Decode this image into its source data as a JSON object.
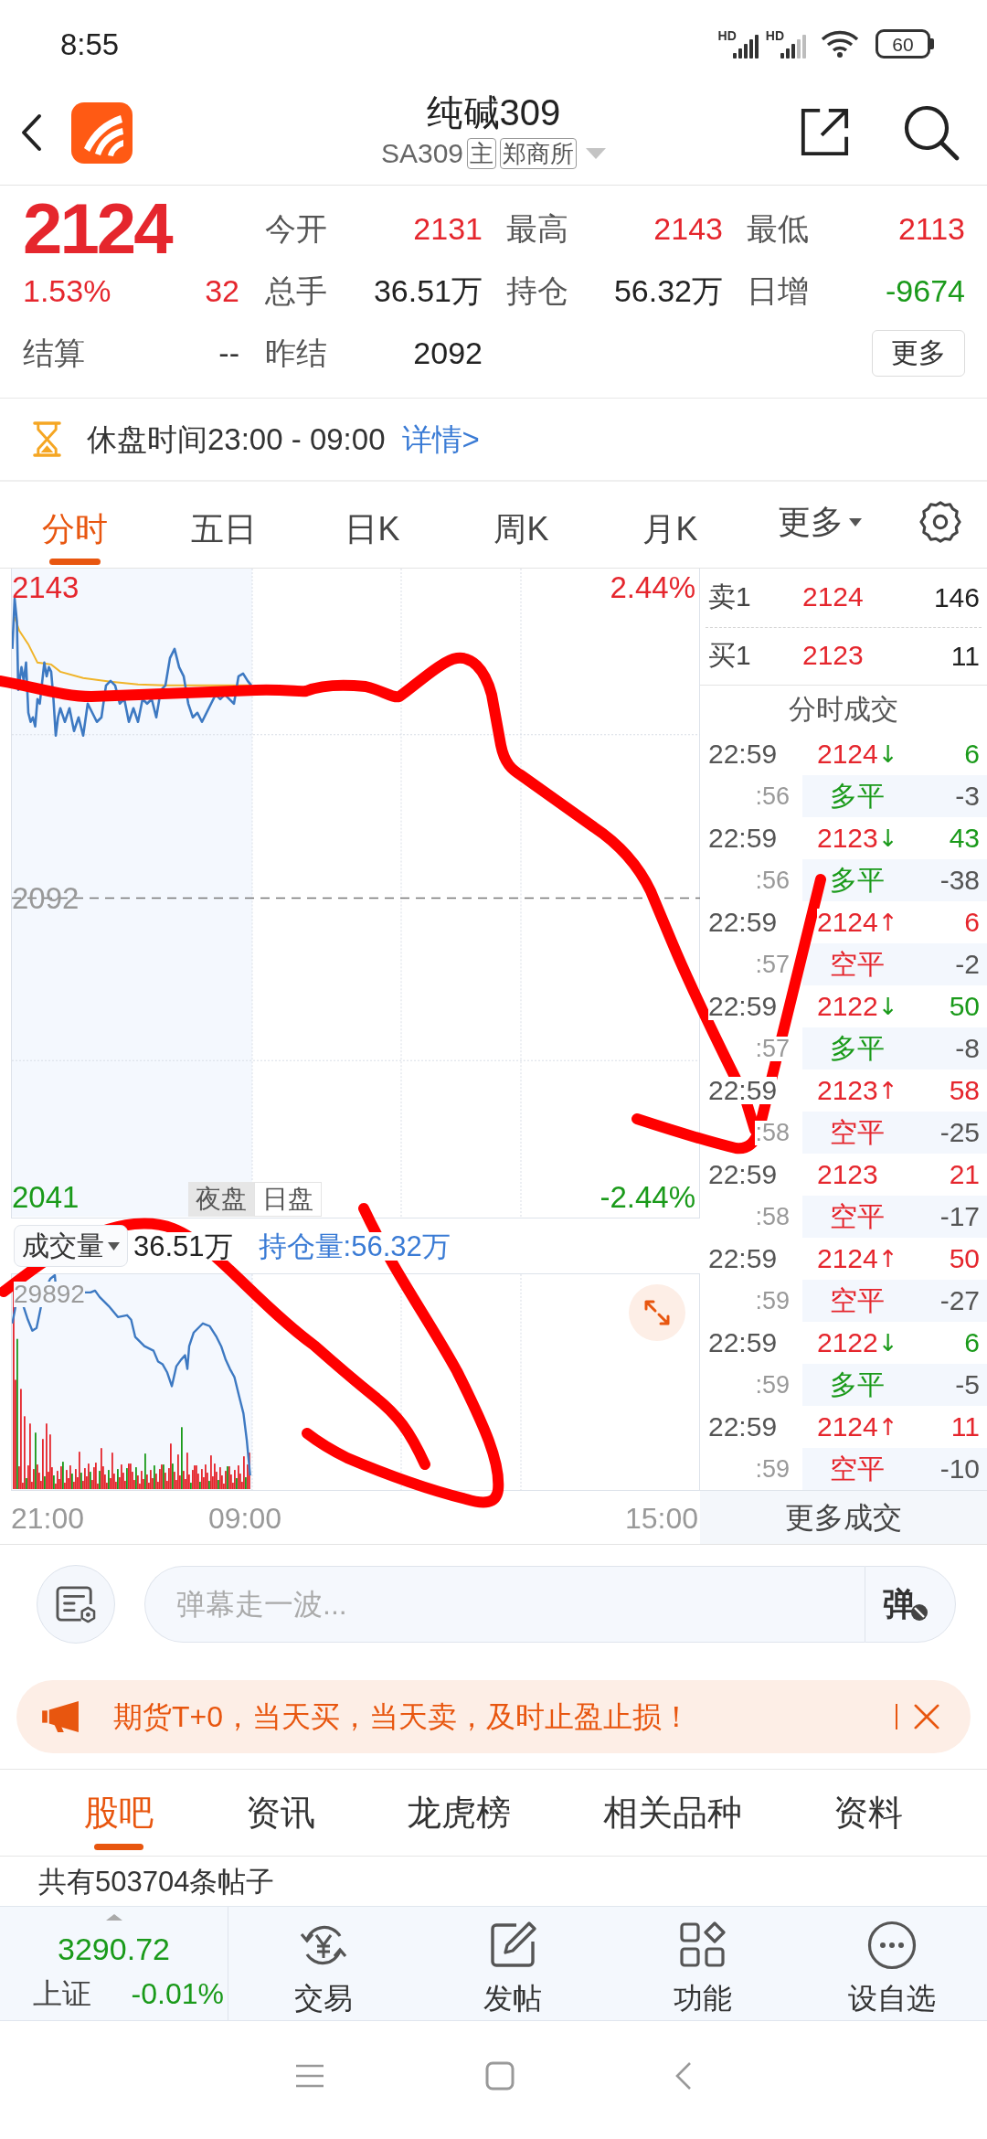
{
  "status_bar": {
    "time": "8:55",
    "signal_labels": [
      "HD",
      "HD"
    ],
    "battery": "60"
  },
  "header": {
    "title": "纯碱309",
    "code": "SA309",
    "tags": [
      "主",
      "郑商所"
    ]
  },
  "quote": {
    "price": "2124",
    "change_pct": "1.53%",
    "change": "32",
    "color": "#e5262d",
    "settlement_label": "结算",
    "settlement_value": "--",
    "stats": [
      {
        "label": "今开",
        "value": "2131",
        "color": "#e5262d"
      },
      {
        "label": "最高",
        "value": "2143",
        "color": "#e5262d"
      },
      {
        "label": "最低",
        "value": "2113",
        "color": "#e5262d"
      },
      {
        "label": "总手",
        "value": "36.51万",
        "color": "#222222"
      },
      {
        "label": "持仓",
        "value": "56.32万",
        "color": "#222222"
      },
      {
        "label": "日增",
        "value": "-9674",
        "color": "#1a9a1a"
      },
      {
        "label": "昨结",
        "value": "2092",
        "color": "#222222"
      }
    ],
    "more_button": "更多"
  },
  "session_notice": {
    "text": "休盘时间23:00 - 09:00",
    "link": "详情>"
  },
  "chart_tabs": [
    {
      "label": "分时",
      "selected": true,
      "kind": "tab"
    },
    {
      "label": "五日",
      "selected": false,
      "kind": "tab"
    },
    {
      "label": "日K",
      "selected": false,
      "kind": "tab"
    },
    {
      "label": "周K",
      "selected": false,
      "kind": "tab"
    },
    {
      "label": "月K",
      "selected": false,
      "kind": "tab"
    },
    {
      "label": "更多",
      "selected": false,
      "kind": "menu"
    }
  ],
  "price_chart": {
    "high": "2143",
    "high_pct": "2.44%",
    "base": "2092",
    "low": "2041",
    "low_pct": "-2.44%",
    "sessions": [
      {
        "label": "夜盘",
        "selected": true
      },
      {
        "label": "日盘",
        "selected": false
      }
    ]
  },
  "volume_chart": {
    "selector": "成交量",
    "volume": "36.51万",
    "open_interest": "持仓量:56.32万",
    "max": "29892"
  },
  "time_axis": [
    "21:00",
    "09:00",
    "15:00"
  ],
  "order_book": [
    {
      "side": "卖1",
      "price": "2124",
      "quantity": "146"
    },
    {
      "side": "买1",
      "price": "2123",
      "quantity": "11"
    }
  ],
  "trades": {
    "title": "分时成交",
    "rows": [
      {
        "time": "22:59",
        "price": "2124",
        "arrow": "↓",
        "volume": "6",
        "color": "#1a9a1a",
        "seconds": ":56",
        "action": "多平",
        "change": "-3"
      },
      {
        "time": "22:59",
        "price": "2123",
        "arrow": "↓",
        "volume": "43",
        "color": "#1a9a1a",
        "seconds": ":56",
        "action": "多平",
        "change": "-38"
      },
      {
        "time": "22:59",
        "price": "2124",
        "arrow": "↑",
        "volume": "6",
        "color": "#e5262d",
        "seconds": ":57",
        "action": "空平",
        "change": "-2"
      },
      {
        "time": "22:59",
        "price": "2122",
        "arrow": "↓",
        "volume": "50",
        "color": "#1a9a1a",
        "seconds": ":57",
        "action": "多平",
        "change": "-8"
      },
      {
        "time": "22:59",
        "price": "2123",
        "arrow": "↑",
        "volume": "58",
        "color": "#e5262d",
        "seconds": ":58",
        "action": "空平",
        "change": "-25"
      },
      {
        "time": "22:59",
        "price": "2123",
        "volume": "21",
        "color": "#e5262d",
        "seconds": ":58",
        "action": "空平",
        "change": "-17"
      },
      {
        "time": "22:59",
        "price": "2124",
        "arrow": "↑",
        "volume": "50",
        "color": "#e5262d",
        "seconds": ":59",
        "action": "空平",
        "change": "-27"
      },
      {
        "time": "22:59",
        "price": "2122",
        "arrow": "↓",
        "volume": "6",
        "color": "#1a9a1a",
        "seconds": ":59",
        "action": "多平",
        "change": "-5"
      },
      {
        "time": "22:59",
        "price": "2124",
        "arrow": "↑",
        "volume": "11",
        "color": "#e5262d",
        "seconds": ":59",
        "action": "空平",
        "change": "-10"
      }
    ],
    "more": "更多成交"
  },
  "danmaku": {
    "placeholder": "弹幕走一波...",
    "toggle": "弹"
  },
  "banner": {
    "text": "期货T+0，当天买，当天卖，及时止盈止损！"
  },
  "content_tabs": [
    {
      "label": "股吧",
      "selected": true
    },
    {
      "label": "资讯",
      "selected": false
    },
    {
      "label": "龙虎榜",
      "selected": false
    },
    {
      "label": "相关品种",
      "selected": false
    },
    {
      "label": "资料",
      "selected": false
    }
  ],
  "post_count": "共有503704条帖子",
  "bottom_bar": {
    "index": {
      "value": "3290.72",
      "name": "上证",
      "change": "-0.01%",
      "color": "#1a9a1a"
    },
    "items": [
      "交易",
      "发帖",
      "功能",
      "设自选"
    ]
  }
}
